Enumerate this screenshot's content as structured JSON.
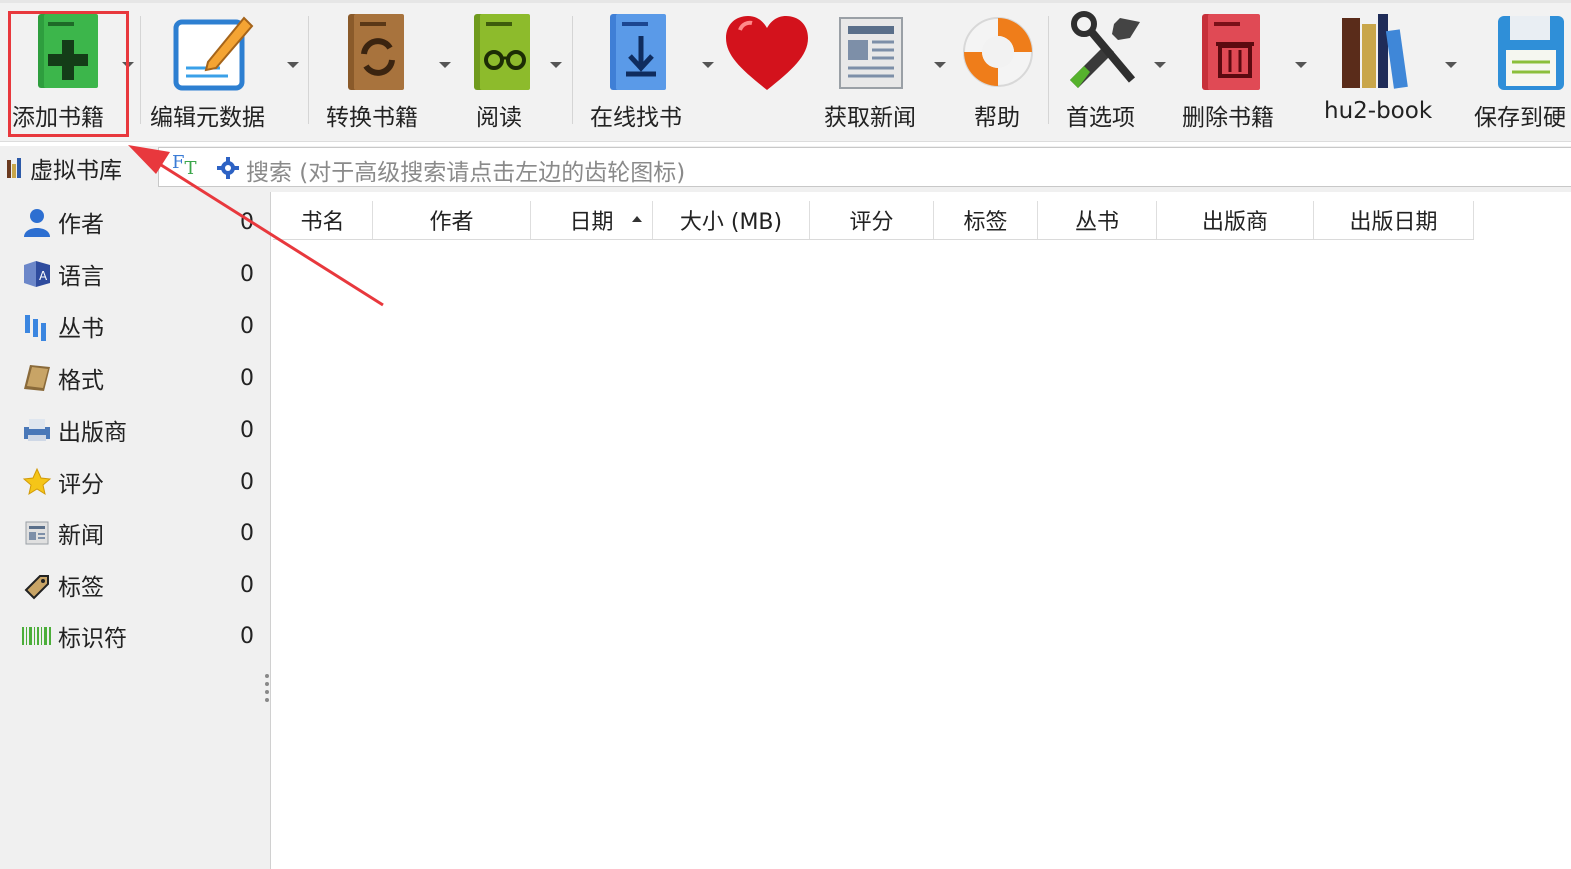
{
  "toolbar": {
    "add_books": "添加书籍",
    "edit_metadata": "编辑元数据",
    "convert_books": "转换书籍",
    "view": "阅读",
    "get_books": "在线找书",
    "fetch_news": "获取新闻",
    "help": "帮助",
    "preferences": "首选项",
    "remove_books": "删除书籍",
    "library": "hu2-book",
    "save_to_disk": "保存到硬"
  },
  "search": {
    "virtual_library": "虚拟书库",
    "placeholder": "搜索 (对于高级搜索请点击左边的齿轮图标)"
  },
  "tag_browser": {
    "items": [
      {
        "label": "作者",
        "count": "0",
        "icon": "person-icon"
      },
      {
        "label": "语言",
        "count": "0",
        "icon": "language-icon"
      },
      {
        "label": "丛书",
        "count": "0",
        "icon": "series-icon"
      },
      {
        "label": "格式",
        "count": "0",
        "icon": "format-book-icon"
      },
      {
        "label": "出版商",
        "count": "0",
        "icon": "publisher-icon"
      },
      {
        "label": "评分",
        "count": "0",
        "icon": "star-icon"
      },
      {
        "label": "新闻",
        "count": "0",
        "icon": "news-icon"
      },
      {
        "label": "标签",
        "count": "0",
        "icon": "tag-icon"
      },
      {
        "label": "标识符",
        "count": "0",
        "icon": "barcode-icon"
      }
    ]
  },
  "table": {
    "columns": [
      "书名",
      "作者",
      "日期",
      "大小 (MB)",
      "评分",
      "标签",
      "丛书",
      "出版商",
      "出版日期"
    ]
  },
  "colors": {
    "highlight": "#e8383d",
    "arrow": "#e8383d"
  }
}
